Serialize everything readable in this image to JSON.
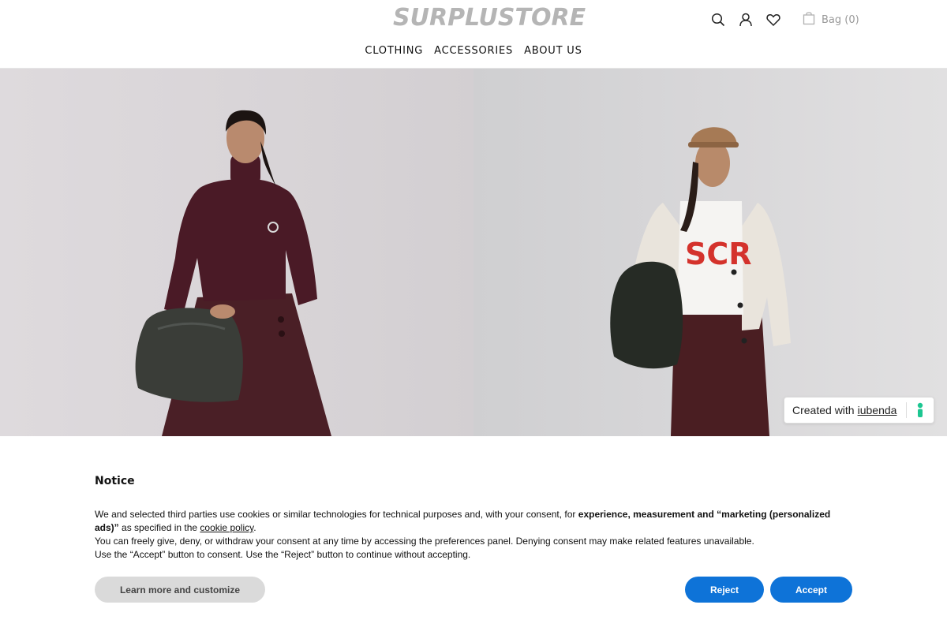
{
  "header": {
    "logo": "SURPLUSTORE",
    "bag_label": "Bag (0)",
    "icons": [
      "search-icon",
      "user-icon",
      "heart-icon",
      "bag-icon"
    ]
  },
  "nav": {
    "items": [
      "CLOTHING",
      "ACCESSORIES",
      "ABOUT US"
    ]
  },
  "badge": {
    "prefix": "Created with",
    "link": "iubenda"
  },
  "notice": {
    "title": "Notice",
    "line1_a": "We and selected third parties use cookies or similar technologies for technical purposes and, with your consent, for ",
    "line1_bold": "experience, measurement and “marketing (personalized ads)”",
    "line1_b": " as specified in the ",
    "cookie_policy": "cookie policy",
    "line1_c": ".",
    "line2": "You can freely give, deny, or withdraw your consent at any time by accessing the preferences panel. Denying consent may make related features unavailable.",
    "line3": "Use the “Accept” button to consent. Use the “Reject” button to continue without accepting.",
    "learn_more": "Learn more and customize",
    "reject": "Reject",
    "accept": "Accept"
  },
  "colors": {
    "accent": "#0e73d8",
    "iubenda_green": "#1cc691"
  }
}
